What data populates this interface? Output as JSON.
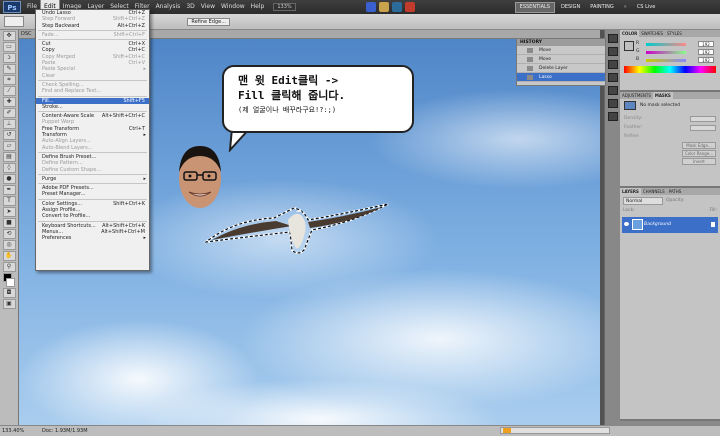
{
  "menubar": {
    "logo": "Ps",
    "items": [
      "File",
      "Edit",
      "Image",
      "Layer",
      "Select",
      "Filter",
      "Analysis",
      "3D",
      "View",
      "Window",
      "Help"
    ],
    "active_item": "Edit",
    "zoom": "133%",
    "workspaces": [
      "ESSENTIALS",
      "DESIGN",
      "PAINTING"
    ],
    "active_workspace": "ESSENTIALS",
    "live": "CS Live"
  },
  "optionsbar": {
    "refine_edge": "Refine Edge..."
  },
  "document_tab": "DSC",
  "edit_menu": {
    "items": [
      {
        "label": "Undo Lasso",
        "shortcut": "Ctrl+Z",
        "state": "enabled"
      },
      {
        "label": "Step Forward",
        "shortcut": "Shift+Ctrl+Z",
        "state": "disabled"
      },
      {
        "label": "Step Backward",
        "shortcut": "Alt+Ctrl+Z",
        "state": "enabled"
      },
      {
        "sep": true
      },
      {
        "label": "Fade...",
        "shortcut": "Shift+Ctrl+F",
        "state": "disabled"
      },
      {
        "sep": true
      },
      {
        "label": "Cut",
        "shortcut": "Ctrl+X",
        "state": "enabled"
      },
      {
        "label": "Copy",
        "shortcut": "Ctrl+C",
        "state": "enabled"
      },
      {
        "label": "Copy Merged",
        "shortcut": "Shift+Ctrl+C",
        "state": "disabled"
      },
      {
        "label": "Paste",
        "shortcut": "Ctrl+V",
        "state": "disabled"
      },
      {
        "label": "Paste Special",
        "shortcut": "",
        "state": "disabled",
        "submenu": true
      },
      {
        "label": "Clear",
        "shortcut": "",
        "state": "disabled"
      },
      {
        "sep": true
      },
      {
        "label": "Check Spelling...",
        "shortcut": "",
        "state": "disabled"
      },
      {
        "label": "Find and Replace Text...",
        "shortcut": "",
        "state": "disabled"
      },
      {
        "sep": true
      },
      {
        "label": "Fill...",
        "shortcut": "Shift+F5",
        "state": "highlighted"
      },
      {
        "label": "Stroke...",
        "shortcut": "",
        "state": "enabled"
      },
      {
        "sep": true
      },
      {
        "label": "Content-Aware Scale",
        "shortcut": "Alt+Shift+Ctrl+C",
        "state": "enabled"
      },
      {
        "label": "Puppet Warp",
        "shortcut": "",
        "state": "disabled"
      },
      {
        "label": "Free Transform",
        "shortcut": "Ctrl+T",
        "state": "enabled"
      },
      {
        "label": "Transform",
        "shortcut": "",
        "state": "enabled",
        "submenu": true
      },
      {
        "label": "Auto-Align Layers...",
        "shortcut": "",
        "state": "disabled"
      },
      {
        "label": "Auto-Blend Layers...",
        "shortcut": "",
        "state": "disabled"
      },
      {
        "sep": true
      },
      {
        "label": "Define Brush Preset...",
        "shortcut": "",
        "state": "enabled"
      },
      {
        "label": "Define Pattern...",
        "shortcut": "",
        "state": "disabled"
      },
      {
        "label": "Define Custom Shape...",
        "shortcut": "",
        "state": "disabled"
      },
      {
        "sep": true
      },
      {
        "label": "Purge",
        "shortcut": "",
        "state": "enabled",
        "submenu": true
      },
      {
        "sep": true
      },
      {
        "label": "Adobe PDF Presets...",
        "shortcut": "",
        "state": "enabled"
      },
      {
        "label": "Preset Manager...",
        "shortcut": "",
        "state": "enabled"
      },
      {
        "sep": true
      },
      {
        "label": "Color Settings...",
        "shortcut": "Shift+Ctrl+K",
        "state": "enabled"
      },
      {
        "label": "Assign Profile...",
        "shortcut": "",
        "state": "enabled"
      },
      {
        "label": "Convert to Profile...",
        "shortcut": "",
        "state": "enabled"
      },
      {
        "sep": true
      },
      {
        "label": "Keyboard Shortcuts...",
        "shortcut": "Alt+Shift+Ctrl+K",
        "state": "enabled"
      },
      {
        "label": "Menus...",
        "shortcut": "Alt+Shift+Ctrl+M",
        "state": "enabled"
      },
      {
        "label": "Preferences",
        "shortcut": "",
        "state": "enabled",
        "submenu": true
      }
    ]
  },
  "history": {
    "title": "HISTORY",
    "rows": [
      {
        "label": "Move",
        "active": false
      },
      {
        "label": "Move",
        "active": false
      },
      {
        "label": "Delete Layer",
        "active": false
      },
      {
        "label": "Lasso",
        "active": true
      }
    ]
  },
  "color_panel": {
    "tabs": [
      "COLOR",
      "SWATCHES",
      "STYLES"
    ],
    "channels": [
      {
        "name": "R",
        "value": "192"
      },
      {
        "name": "G",
        "value": "192"
      },
      {
        "name": "B",
        "value": "192"
      }
    ]
  },
  "adjustments_panel": {
    "tabs": [
      "ADJUSTMENTS",
      "MASKS"
    ],
    "no_mask": "No mask selected",
    "fields": [
      "Density:",
      "Feather:"
    ],
    "refine_label": "Refine:",
    "buttons": [
      "Mask Edge...",
      "Color Range...",
      "Invert"
    ]
  },
  "layers_panel": {
    "tabs": [
      "LAYERS",
      "CHANNELS",
      "PATHS"
    ],
    "blend_mode": "Normal",
    "opacity": "Opacity:",
    "lock": "Lock:",
    "fill": "Fill:",
    "layer_name": "Background"
  },
  "statusbar": {
    "zoom": "133.40%",
    "doc": "Doc: 1.93M/1.93M"
  },
  "bubble": {
    "line1": "맨 윗 Edit클릭 ->",
    "line2": "Fill 클릭해 줍니다.",
    "line3": "(제 얼굴이나 배꾸라구요!?:;)"
  },
  "colors": {
    "highlight": "#3c6fc8",
    "sky": "#6ea3da"
  }
}
